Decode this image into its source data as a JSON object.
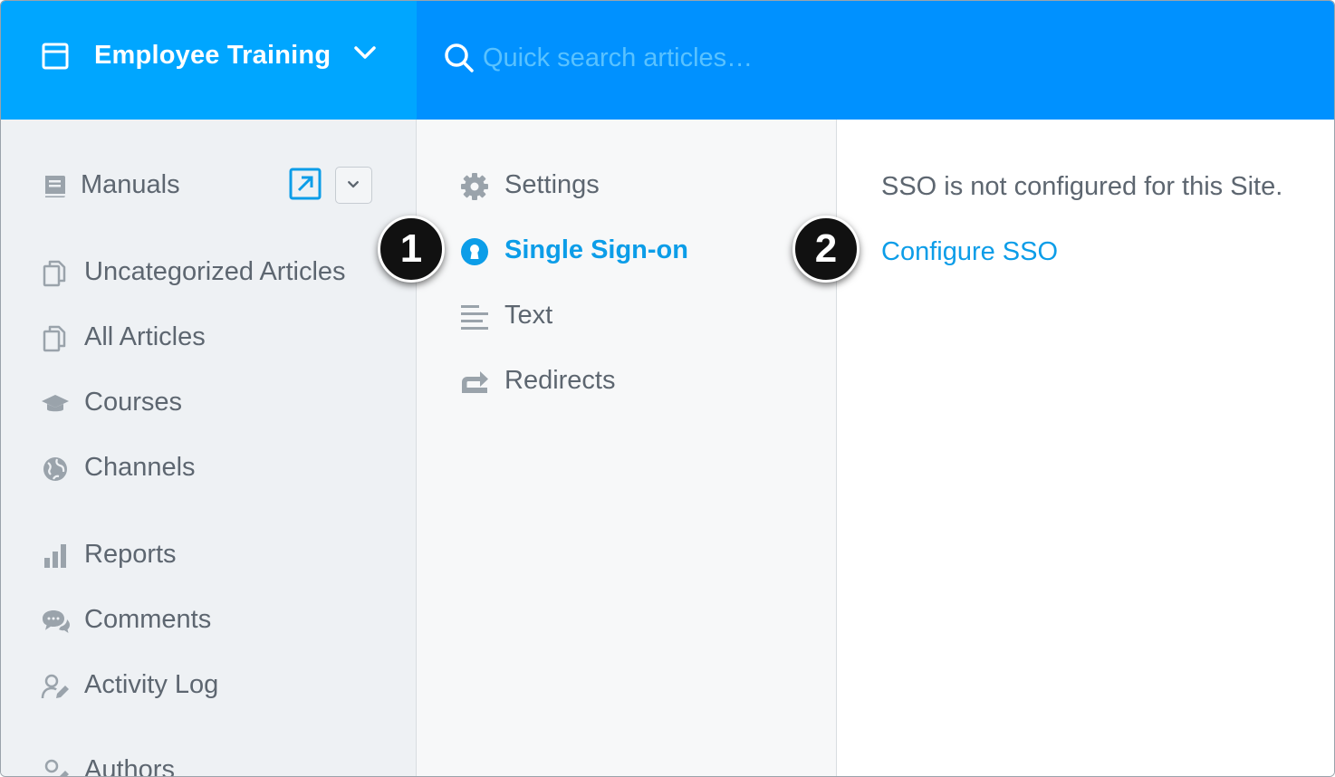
{
  "header": {
    "site_name": "Employee Training",
    "search_placeholder": "Quick search articles…"
  },
  "sidebar": {
    "section_title": "Manuals",
    "items": [
      {
        "label": "Uncategorized Articles",
        "icon": "documents-icon"
      },
      {
        "label": "All Articles",
        "icon": "documents-icon"
      },
      {
        "label": "Courses",
        "icon": "graduation-cap-icon"
      },
      {
        "label": "Channels",
        "icon": "globe-icon"
      },
      {
        "label": "Reports",
        "icon": "bar-chart-icon"
      },
      {
        "label": "Comments",
        "icon": "chat-bubbles-icon"
      },
      {
        "label": "Activity Log",
        "icon": "user-edit-icon"
      },
      {
        "label": "Authors",
        "icon": "user-edit-icon"
      }
    ]
  },
  "settings_nav": {
    "items": [
      {
        "label": "Settings",
        "icon": "gear-icon",
        "active": false
      },
      {
        "label": "Single Sign-on",
        "icon": "keyhole-icon",
        "active": true
      },
      {
        "label": "Text",
        "icon": "text-lines-icon",
        "active": false
      },
      {
        "label": "Redirects",
        "icon": "redirect-arrow-icon",
        "active": false
      }
    ]
  },
  "content": {
    "message": "SSO is not configured for this Site.",
    "link": "Configure SSO"
  },
  "callouts": [
    "1",
    "2"
  ],
  "colors": {
    "header_left": "#00a6ff",
    "header_right": "#0091ff",
    "accent": "#0c9de8",
    "text": "#5d6670"
  }
}
